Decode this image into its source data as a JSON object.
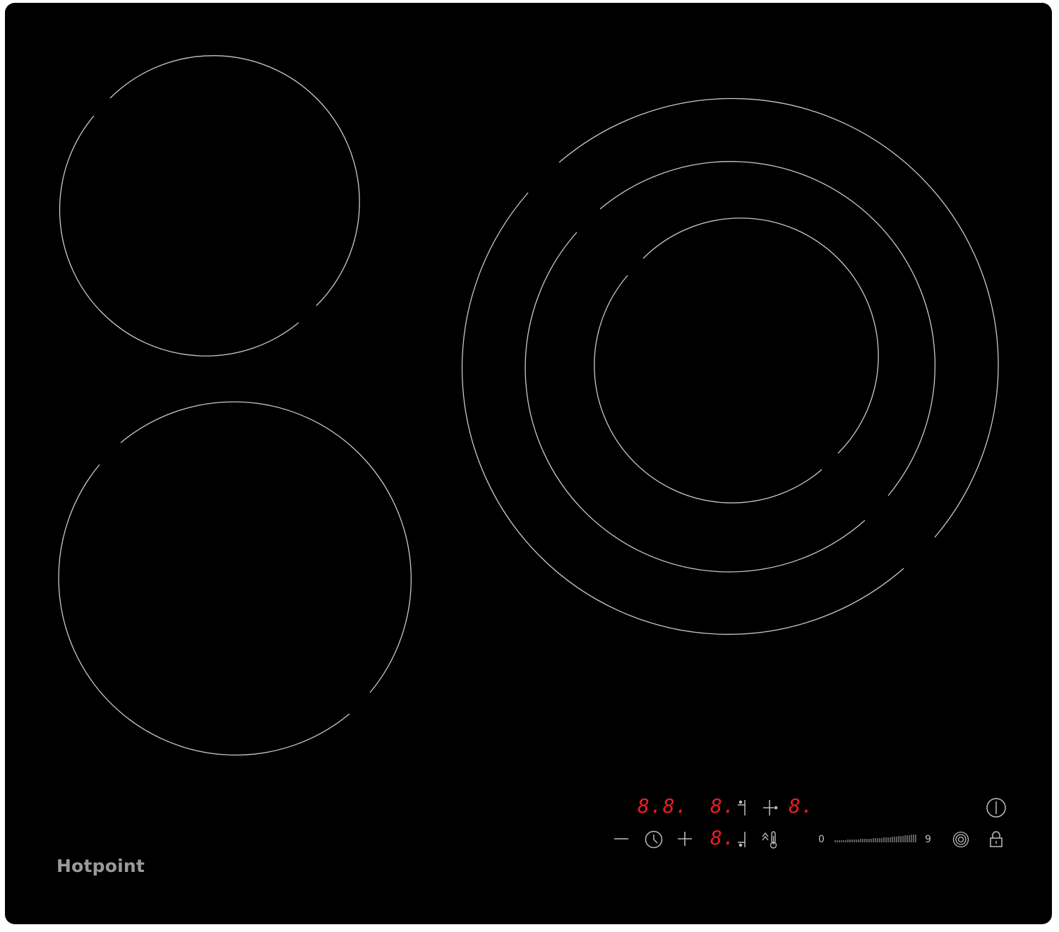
{
  "brand": {
    "name": "Hotpoint"
  },
  "colors": {
    "glass": "#000000",
    "ring": "#c9c9c9",
    "display": "#e41f24",
    "symbol": "#bdbdbd"
  },
  "displays": {
    "timer": "8.8.",
    "zone_front_right": "8.",
    "zone_rear_right": "8.",
    "zone_front_left": "8."
  },
  "slider": {
    "min_label": "0",
    "max_label": "9"
  },
  "icons": [
    "minus-icon",
    "clock-icon",
    "plus-icon",
    "zone-rear-left-indicator-icon",
    "zone-rear-right-indicator-icon",
    "zone-front-left-indicator-icon",
    "keep-warm-icon",
    "boost-icon",
    "power-icon",
    "lock-icon"
  ]
}
